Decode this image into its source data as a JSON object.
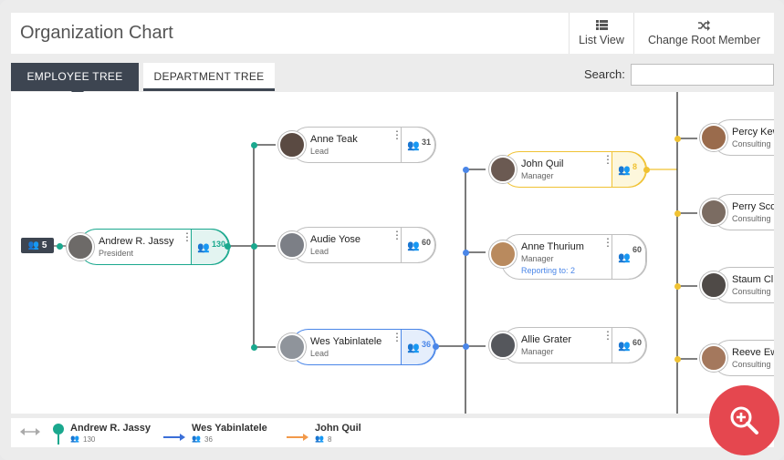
{
  "header": {
    "title": "Organization Chart",
    "list_view_label": "List View",
    "change_root_label": "Change Root Member"
  },
  "tabs": {
    "employee": "EMPLOYEE TREE",
    "department": "DEPARTMENT TREE"
  },
  "search": {
    "label": "Search:",
    "value": "",
    "placeholder": ""
  },
  "root_badge": {
    "count": "5"
  },
  "nodes": {
    "andrew": {
      "name": "Andrew R. Jassy",
      "role": "President",
      "count": "130"
    },
    "anne_teak": {
      "name": "Anne Teak",
      "role": "Lead",
      "count": "31"
    },
    "audie": {
      "name": "Audie Yose",
      "role": "Lead",
      "count": "60"
    },
    "wes": {
      "name": "Wes Yabinlatele",
      "role": "Lead",
      "count": "36"
    },
    "john": {
      "name": "John Quil",
      "role": "Manager",
      "count": "8"
    },
    "anne_thurium": {
      "name": "Anne Thurium",
      "role": "Manager",
      "count": "60",
      "reporting": "Reporting to: 2"
    },
    "allie": {
      "name": "Allie Grater",
      "role": "Manager",
      "count": "60"
    },
    "percy_kew": {
      "name": "Percy Kew",
      "role": "Consulting"
    },
    "perry": {
      "name": "Perry Scop",
      "role": "Consulting"
    },
    "staum": {
      "name": "Staum Cl",
      "role": "Consulting"
    },
    "reeve": {
      "name": "Reeve Ewe",
      "role": "Consulting"
    }
  },
  "legend": {
    "items": [
      {
        "name": "Andrew R. Jassy",
        "count": "130",
        "color": "#1aa88e"
      },
      {
        "name": "Wes Yabinlatele",
        "count": "36",
        "color": "#3b6fd8"
      },
      {
        "name": "John Quil",
        "count": "8",
        "color": "#f2994a"
      }
    ]
  },
  "colors": {
    "teal": "#1aa88e",
    "blue": "#4a86e8",
    "yellow": "#f0c233",
    "dark": "#3d4551",
    "fab": "#e5474f"
  },
  "icons": [
    "list-icon",
    "shuffle-icon",
    "people-icon",
    "kebab-icon",
    "zoom-in-icon",
    "double-arrow-icon",
    "pin-icon",
    "arrow-right-icon"
  ]
}
